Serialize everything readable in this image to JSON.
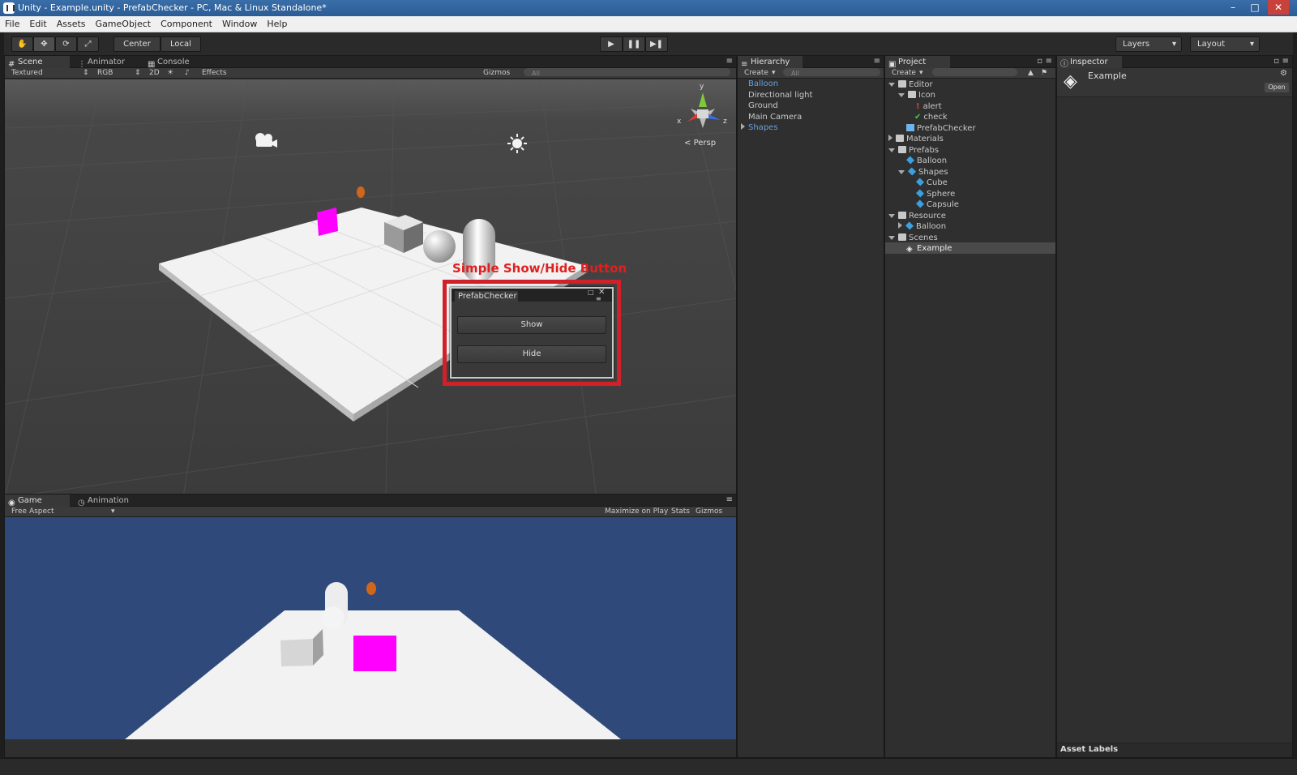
{
  "window": {
    "title": "Unity - Example.unity - PrefabChecker - PC, Mac & Linux Standalone*"
  },
  "menu": [
    "File",
    "Edit",
    "Assets",
    "GameObject",
    "Component",
    "Window",
    "Help"
  ],
  "toolbar": {
    "center": "Center",
    "local": "Local",
    "layers": "Layers",
    "layout": "Layout"
  },
  "scene": {
    "tabs": [
      "Scene",
      "Animator",
      "Console"
    ],
    "render_mode": "Textured",
    "color": "RGB",
    "mode2d": "2D",
    "effects": "Effects",
    "gizmos": "Gizmos",
    "search": "All",
    "persp": "Persp",
    "axes": {
      "x": "x",
      "y": "y",
      "z": "z"
    }
  },
  "annotation": {
    "label": "Simple Show/Hide Button",
    "color": "#e02020"
  },
  "prefab_window": {
    "title": "PrefabChecker",
    "show": "Show",
    "hide": "Hide"
  },
  "game": {
    "tabs": [
      "Game",
      "Animation"
    ],
    "aspect": "Free Aspect",
    "maximize": "Maximize on Play",
    "stats": "Stats",
    "gizmos": "Gizmos",
    "sky": "#2f4a7a"
  },
  "hierarchy": {
    "tab": "Hierarchy",
    "create": "Create",
    "search": "All",
    "items": [
      "Balloon",
      "Directional light",
      "Ground",
      "Main Camera",
      "Shapes"
    ]
  },
  "project": {
    "tab": "Project",
    "create": "Create",
    "tree": [
      "Editor",
      "Icon",
      "alert",
      "check",
      "PrefabChecker",
      "Materials",
      "Prefabs",
      "Balloon",
      "Shapes",
      "Cube",
      "Sphere",
      "Capsule",
      "Resource",
      "Balloon",
      "Scenes",
      "Example"
    ]
  },
  "inspector": {
    "tab": "Inspector",
    "name": "Example",
    "open": "Open",
    "asset_labels": "Asset Labels"
  }
}
